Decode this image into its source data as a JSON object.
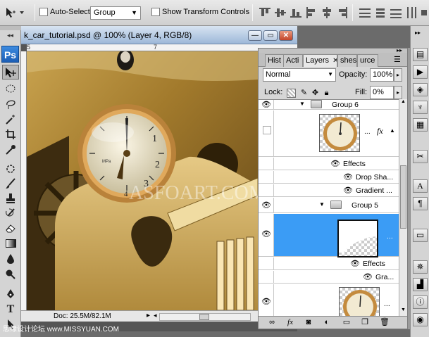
{
  "options_bar": {
    "auto_select_label": "Auto-Select:",
    "auto_select_value": "Group",
    "show_transform_label": "Show Transform Controls"
  },
  "tools": {
    "logo": "Ps",
    "type_tool_glyph": "T"
  },
  "document": {
    "title": "k_car_tutorial.psd @ 100% (Layer 4, RGB/8)",
    "ruler_marks": [
      "5",
      "7"
    ],
    "status": "Doc: 25.5M/82.1M",
    "watermark": "ASFOART.COM",
    "minimize_glyph": "—",
    "maximize_glyph": "▭",
    "close_glyph": "✕"
  },
  "layers_panel": {
    "tabs": [
      "Hist",
      "Acti",
      "Layers",
      "shes",
      "urce"
    ],
    "blend_mode": "Normal",
    "opacity_label": "Opacity:",
    "opacity_value": "100%",
    "lock_label": "Lock:",
    "fill_label": "Fill:",
    "fill_value": "0%",
    "group6_name": "Group 6",
    "effects_label": "Effects",
    "drop_shadow_label": "Drop Sha...",
    "gradient_label": "Gradient ...",
    "group5_name": "Group 5",
    "effects2_label": "Effects",
    "gra_label": "Gra...",
    "fx_label": "fx",
    "ellipsis": "..."
  },
  "bottom_watermark": "思缘设计论坛 www.MISSYUAN.COM",
  "colors": {
    "selection_blue": "#3b9cf5",
    "titlebar_blue": "#9db8d8"
  }
}
